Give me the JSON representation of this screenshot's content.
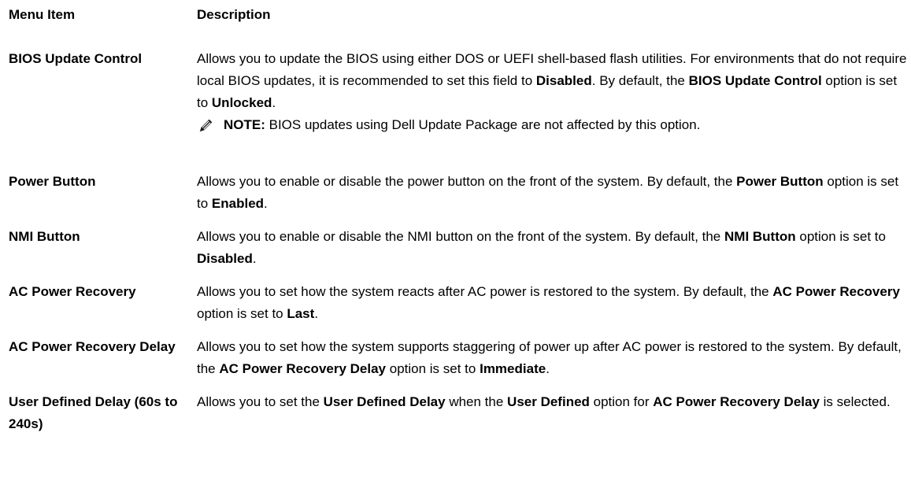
{
  "header": {
    "col1": "Menu Item",
    "col2": "Description"
  },
  "rows": [
    {
      "term": "BIOS Update Control",
      "desc": [
        {
          "t": "Allows you to update the BIOS using either DOS or UEFI shell-based flash utilities. For environments that do not require local BIOS updates, it is recommended to set this field to "
        },
        {
          "t": "Disabled",
          "b": true
        },
        {
          "t": ". By default, the "
        },
        {
          "t": "BIOS Update Control",
          "b": true
        },
        {
          "t": " option is set to "
        },
        {
          "t": "Unlocked",
          "b": true
        },
        {
          "t": "."
        }
      ]
    },
    {
      "term": "Power Button",
      "desc": [
        {
          "t": "Allows you to enable or disable the power button on the front of the system. By default, the "
        },
        {
          "t": "Power Button",
          "b": true
        },
        {
          "t": " option is set to "
        },
        {
          "t": "Enabled",
          "b": true
        },
        {
          "t": "."
        }
      ]
    },
    {
      "term": "NMI Button",
      "desc": [
        {
          "t": "Allows you to enable or disable the NMI button on the front of the system. By default, the "
        },
        {
          "t": "NMI Button",
          "b": true
        },
        {
          "t": " option is set to "
        },
        {
          "t": "Disabled",
          "b": true
        },
        {
          "t": "."
        }
      ]
    },
    {
      "term": "AC Power Recovery",
      "desc": [
        {
          "t": "Allows you to set how the system reacts after AC power is restored to the system. By default, the "
        },
        {
          "t": "AC Power Recovery",
          "b": true
        },
        {
          "t": " option is set to "
        },
        {
          "t": "Last",
          "b": true
        },
        {
          "t": "."
        }
      ]
    },
    {
      "term": "AC Power Recovery Delay",
      "desc": [
        {
          "t": "Allows you to set how the system supports staggering of power up after AC power is restored to the system. By default, the "
        },
        {
          "t": "AC Power Recovery Delay",
          "b": true
        },
        {
          "t": " option is set to "
        },
        {
          "t": "Immediate",
          "b": true
        },
        {
          "t": "."
        }
      ]
    },
    {
      "term": "User Defined Delay (60s to 240s)",
      "desc": [
        {
          "t": "Allows you to set the "
        },
        {
          "t": "User Defined Delay",
          "b": true
        },
        {
          "t": " when the "
        },
        {
          "t": "User Defined",
          "b": true
        },
        {
          "t": " option for "
        },
        {
          "t": "AC Power Recovery Delay",
          "b": true
        },
        {
          "t": " is selected."
        }
      ]
    }
  ],
  "note": {
    "label": "NOTE:",
    "text": " BIOS updates using Dell Update Package are not affected by this option.",
    "icon": "pencil-icon"
  }
}
